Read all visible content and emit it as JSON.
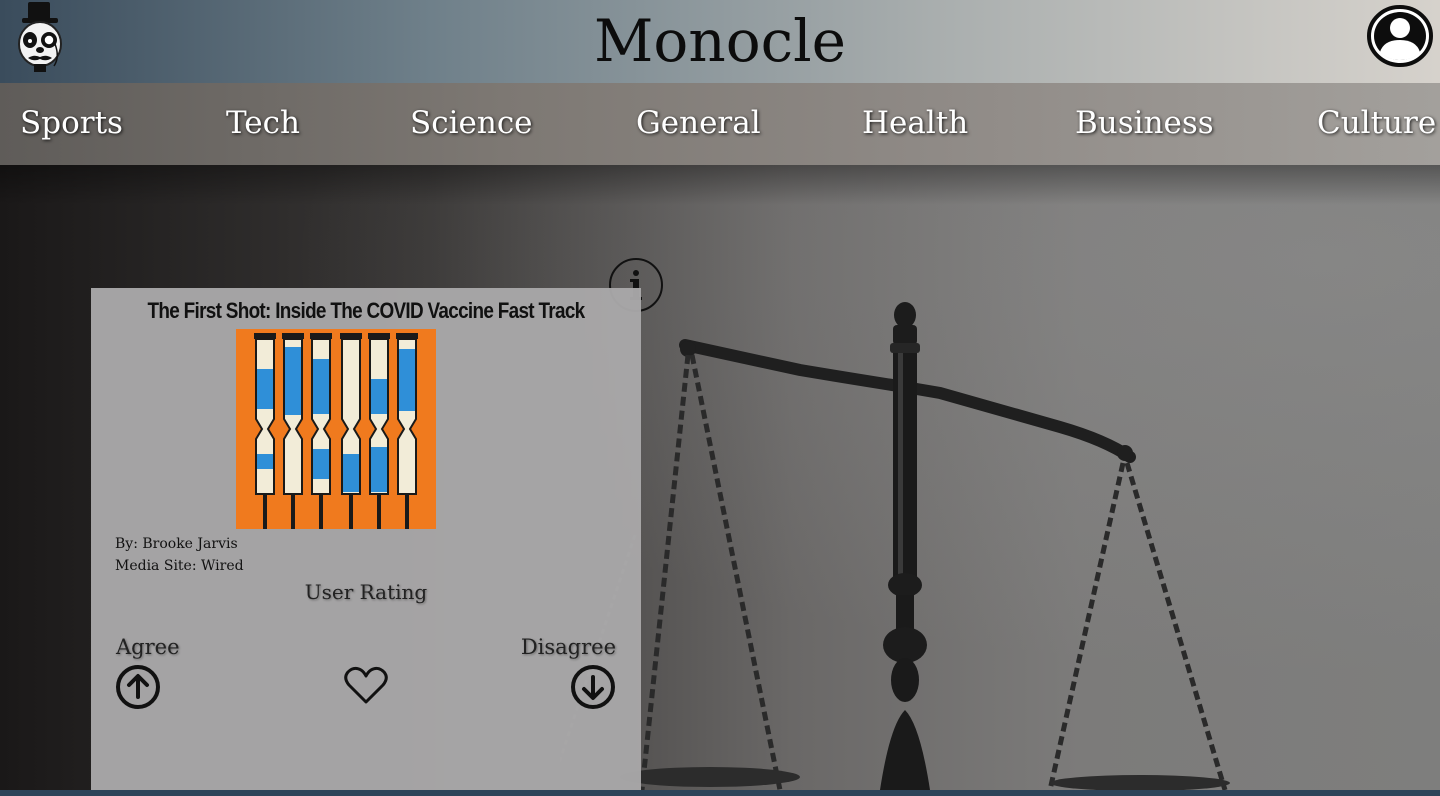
{
  "header": {
    "brand": "Monocle",
    "logo_icon": "monocle-gentleman-logo-icon",
    "profile_icon": "user-avatar-icon"
  },
  "nav": {
    "items": [
      {
        "label": "Sports"
      },
      {
        "label": "Tech"
      },
      {
        "label": "Science"
      },
      {
        "label": "General"
      },
      {
        "label": "Health"
      },
      {
        "label": "Business"
      },
      {
        "label": "Culture"
      }
    ]
  },
  "hero": {
    "background_icon": "scales-of-justice-image"
  },
  "info": {
    "icon": "info-icon"
  },
  "article": {
    "title": "The First Shot: Inside The COVID Vaccine Fast Track",
    "image_icon": "vaccine-syringes-illustration",
    "author": "By: Brooke Jarvis",
    "media_site": "Media Site: Wired",
    "rating_label": "User Rating",
    "agree_label": "Agree",
    "disagree_label": "Disagree",
    "upvote_icon": "arrow-up-circle-icon",
    "favorite_icon": "heart-icon",
    "downvote_icon": "arrow-down-circle-icon"
  },
  "colors": {
    "image_background": "#f07a1e",
    "syringe_fill": "#2f8fd8",
    "card_background": "#a8a7a8"
  }
}
